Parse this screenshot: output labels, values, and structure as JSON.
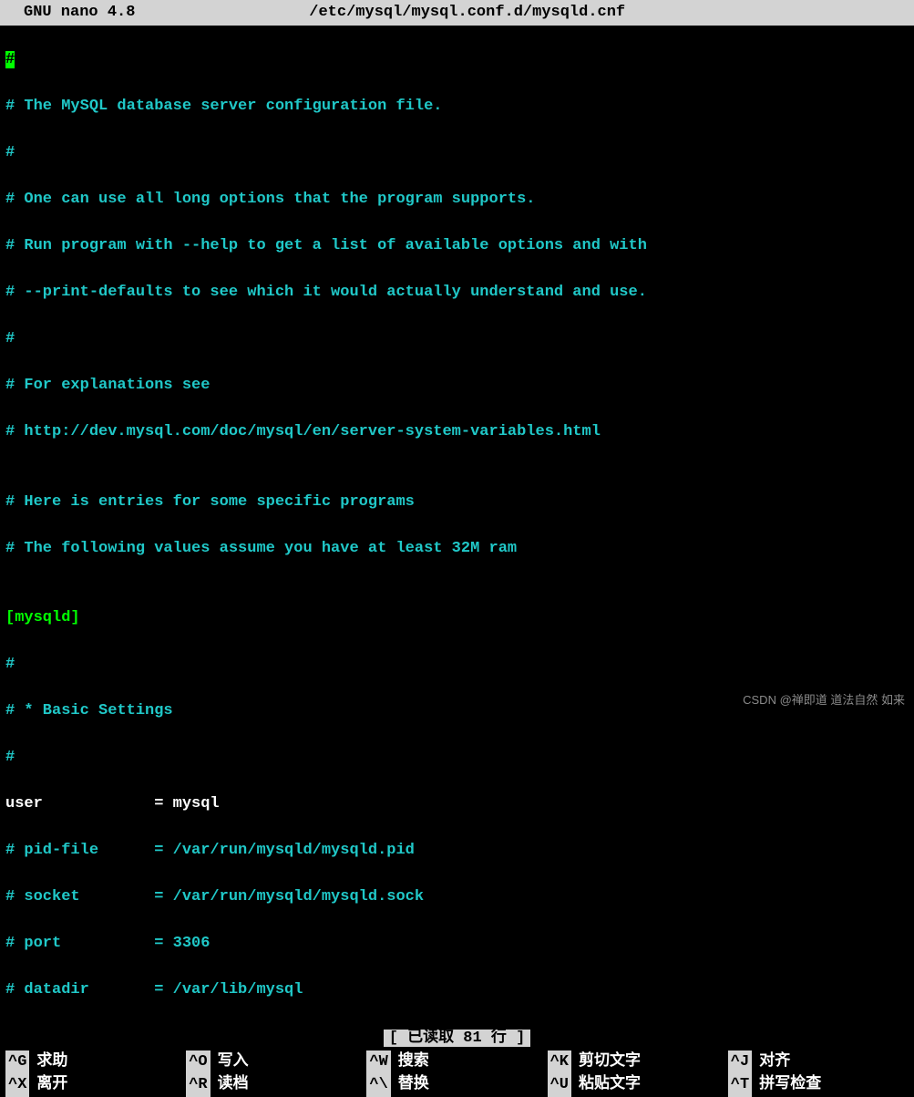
{
  "titlebar": {
    "app": "GNU nano 4.8",
    "file": "/etc/mysql/mysql.conf.d/mysqld.cnf"
  },
  "lines": {
    "l1": "#",
    "l2": "# The MySQL database server configuration file.",
    "l3": "#",
    "l4": "# One can use all long options that the program supports.",
    "l5": "# Run program with --help to get a list of available options and with",
    "l6": "# --print-defaults to see which it would actually understand and use.",
    "l7": "#",
    "l8": "# For explanations see",
    "l9": "# http://dev.mysql.com/doc/mysql/en/server-system-variables.html",
    "l10": "",
    "l11": "# Here is entries for some specific programs",
    "l12": "# The following values assume you have at least 32M ram",
    "l13": "",
    "l14": "[mysqld]",
    "l15": "#",
    "l16": "# * Basic Settings",
    "l17": "#",
    "l18": "user            = mysql",
    "l19": "# pid-file      = /var/run/mysqld/mysqld.pid",
    "l20": "# socket        = /var/run/mysqld/mysqld.sock",
    "l21": "# port          = 3306",
    "l22": "# datadir       = /var/lib/mysql"
  },
  "status": "[ 已读取 81 行 ]",
  "help": {
    "row1": {
      "k1": "^G",
      "l1": "求助",
      "k2": "^O",
      "l2": "写入",
      "k3": "^W",
      "l3": "搜索",
      "k4": "^K",
      "l4": "剪切文字",
      "k5": "^J",
      "l5": "对齐"
    },
    "row2": {
      "k1": "^X",
      "l1": "离开",
      "k2": "^R",
      "l2": "读档",
      "k3": "^\\",
      "l3": "替换",
      "k4": "^U",
      "l4": "粘贴文字",
      "k5": "^T",
      "l5": "拼写检查"
    }
  },
  "watermark": "CSDN @禅即道 道法自然 如来"
}
